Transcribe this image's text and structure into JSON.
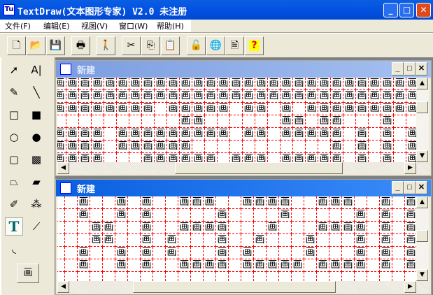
{
  "app": {
    "title": "TextDraw(文本图形专家) V2.0 未注册",
    "icon": "Tu"
  },
  "window_buttons": {
    "minimize": "_",
    "maximize": "□",
    "close": "✕"
  },
  "menu": [
    "文件(F)",
    "编辑(E)",
    "视图(V)",
    "窗口(W)",
    "帮助(H)"
  ],
  "toolbar": [
    {
      "icon": "new-document-icon",
      "glyph": "🗋"
    },
    {
      "icon": "open-folder-icon",
      "glyph": "📂"
    },
    {
      "icon": "save-disk-icon",
      "glyph": "💾"
    },
    {
      "icon": "print-icon",
      "glyph": "🖶"
    },
    {
      "icon": "run-icon",
      "glyph": "🚶"
    },
    {
      "icon": "cut-icon",
      "glyph": "✂"
    },
    {
      "icon": "copy-icon",
      "glyph": "⎘"
    },
    {
      "icon": "paste-icon",
      "glyph": "📋"
    },
    {
      "icon": "lock-icon",
      "glyph": "🔓"
    },
    {
      "icon": "globe-icon",
      "glyph": "🌐"
    },
    {
      "icon": "document-icon",
      "glyph": "🗎"
    },
    {
      "icon": "help-icon",
      "glyph": "?"
    }
  ],
  "tools": [
    {
      "icon": "pointer-arrow-icon",
      "glyph": "➚"
    },
    {
      "icon": "text-cursor-icon",
      "glyph": "A|"
    },
    {
      "icon": "pencil-icon",
      "glyph": "✎"
    },
    {
      "icon": "line-icon",
      "glyph": "╲"
    },
    {
      "icon": "rectangle-outline-icon",
      "glyph": "□"
    },
    {
      "icon": "rectangle-filled-icon",
      "glyph": "■"
    },
    {
      "icon": "ellipse-outline-icon",
      "glyph": "○"
    },
    {
      "icon": "ellipse-filled-icon",
      "glyph": "●"
    },
    {
      "icon": "rounded-rect-outline-icon",
      "glyph": "▢"
    },
    {
      "icon": "rounded-rect-filled-icon",
      "glyph": "▩"
    },
    {
      "icon": "polygon-outline-icon",
      "glyph": "⏢"
    },
    {
      "icon": "polygon-filled-icon",
      "glyph": "▰"
    },
    {
      "icon": "eraser-icon",
      "glyph": "✐"
    },
    {
      "icon": "spray-can-icon",
      "glyph": "⁂"
    },
    {
      "icon": "text-tool-icon",
      "glyph": "T"
    },
    {
      "icon": "eyedropper-icon",
      "glyph": "⟋"
    },
    {
      "icon": "curve-icon",
      "glyph": "◟"
    }
  ],
  "char_button": "画",
  "fill_char": "画",
  "windows": [
    {
      "title": "新建",
      "active": false,
      "rows": [
        "11111111111111111111111111111",
        "11111111111111111111111111111",
        "11111111011111011010111111111",
        "00000000001100000011011000100",
        "11110111111111011011111010101",
        "11110111111000000000001010101",
        "11110001111110111011111010101"
      ]
    },
    {
      "title": "新建",
      "active": true,
      "rows": [
        "00100101001110011110011100101",
        "00100101000001000010000010101",
        "00011001001111000100011110101",
        "00011001010001001000100010101",
        "00100101010001010000100010101",
        "00100101001111011111011110101",
        "00000000000000000000000000000"
      ]
    }
  ],
  "colors": {
    "titlebar": "#0054e3",
    "inactive_title": "#8aa8e6",
    "grid_line": "#ff0000"
  }
}
